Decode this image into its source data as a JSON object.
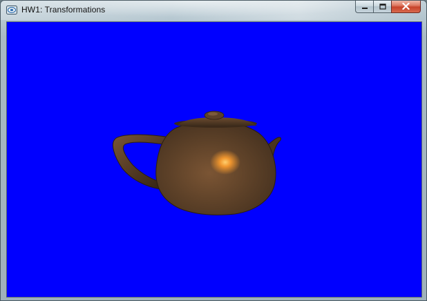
{
  "window": {
    "title": "HW1: Transformations",
    "app_icon": "opengl-app-icon",
    "controls": {
      "minimize_icon": "minimize-icon",
      "maximize_icon": "maximize-icon",
      "close_icon": "close-icon"
    }
  },
  "viewport": {
    "background_color": "#0000ff",
    "object": "teapot",
    "object_color": "#6b4a2f",
    "highlight_color": "#f0962e"
  }
}
